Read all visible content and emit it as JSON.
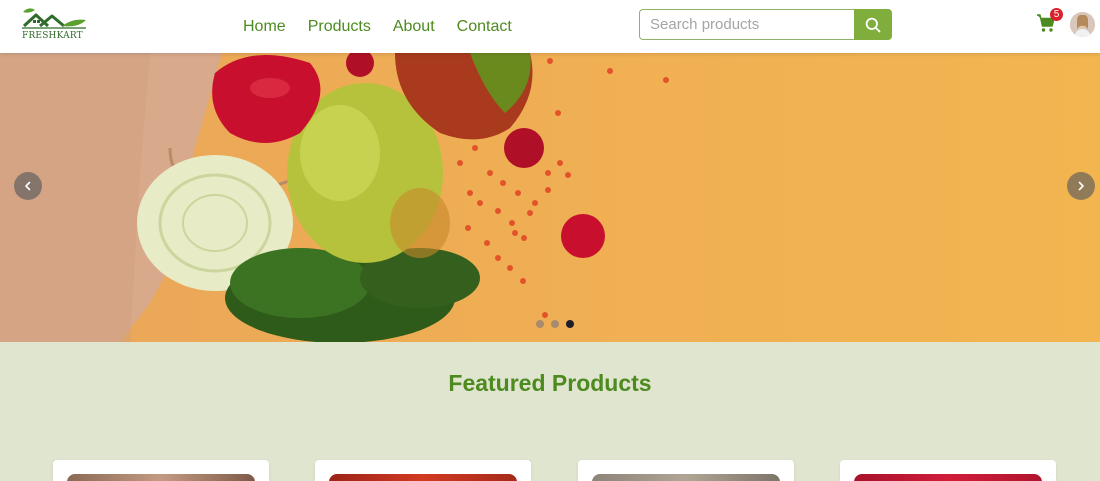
{
  "brand": {
    "name": "FRESHKART"
  },
  "nav": {
    "links": [
      "Home",
      "Products",
      "About",
      "Contact"
    ]
  },
  "search": {
    "placeholder": "Search products",
    "value": ""
  },
  "cart": {
    "count": "5"
  },
  "hero": {
    "slide_count": 3,
    "active_slide": 3
  },
  "featured": {
    "title": "Featured Products"
  },
  "colors": {
    "brand_green": "#4d8a1f",
    "accent_green": "#7fae3c",
    "badge_red": "#d9202b",
    "hero_orange": "#efae54"
  },
  "icons": [
    "logo-house-leaf-icon",
    "search-icon",
    "cart-icon",
    "chevron-left-icon",
    "chevron-right-icon"
  ]
}
